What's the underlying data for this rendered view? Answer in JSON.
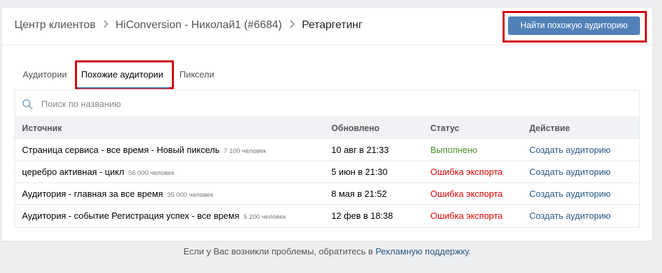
{
  "breadcrumb": {
    "items": [
      "Центр клиентов",
      "HiConversion - Николай1 (#6684)"
    ],
    "current": "Ретаргетинг"
  },
  "header": {
    "find_button_label": "Найти похожую аудиторию"
  },
  "tabs": [
    {
      "label": "Аудитории"
    },
    {
      "label": "Похожие аудитории",
      "active": true
    },
    {
      "label": "Пиксели"
    }
  ],
  "search": {
    "placeholder": "Поиск по названию",
    "value": ""
  },
  "table": {
    "columns": [
      "Источник",
      "Обновлено",
      "Статус",
      "Действие"
    ],
    "rows": [
      {
        "source": "Страница сервиса - все время - Новый пиксель",
        "count": "7 100 человек",
        "updated": "10 авг в 21:33",
        "status": "Выполнено",
        "action": "Создать аудиторию"
      },
      {
        "source": "церебро активная - цикл",
        "count": "56 000 человек",
        "updated": "5 июн в 21:30",
        "status": "Ошибка экспорта",
        "action": "Создать аудиторию"
      },
      {
        "source": "Аудитория - главная  за все время",
        "count": "35 000 человек",
        "updated": "8 мая в 21:52",
        "status": "Ошибка экспорта",
        "action": "Создать аудиторию"
      },
      {
        "source": "Аудитория - событие Регистрация успех - все время",
        "count": "5 200 человек",
        "updated": "12 фев в 18:38",
        "status": "Ошибка экспорта",
        "action": "Создать аудиторию"
      }
    ]
  },
  "footer": {
    "text": "Если у Вас возникли проблемы, обратитесь в ",
    "link": "Рекламную поддержку",
    "end": "."
  },
  "colors": {
    "accent": "#5181b8",
    "link": "#2a5885",
    "success": "#4a8f29",
    "error": "#dd0000",
    "highlight_frame": "#d2030f"
  }
}
